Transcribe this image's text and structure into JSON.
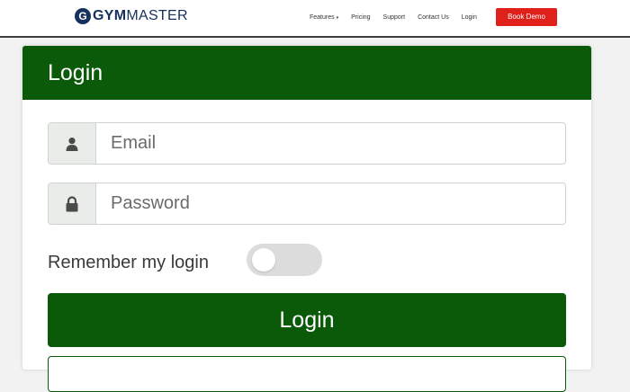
{
  "navbar": {
    "logo_mark": "G",
    "logo_gym": "GYM",
    "logo_master": "MASTER",
    "links": [
      {
        "label": "Features",
        "has_caret": true
      },
      {
        "label": "Pricing"
      },
      {
        "label": "Support"
      },
      {
        "label": "Contact Us"
      },
      {
        "label": "Login"
      }
    ],
    "caret_glyph": "▾",
    "demo_button_label": "Book Demo",
    "demo_button_color": "#e0201a"
  },
  "login_card": {
    "title": "Login",
    "header_color": "#0a5a0a",
    "email": {
      "placeholder": "Email",
      "value": "",
      "icon": "user-icon"
    },
    "password": {
      "placeholder": "Password",
      "value": "",
      "icon": "lock-icon"
    },
    "remember_label": "Remember my login",
    "remember_enabled": false,
    "submit_label": "Login"
  }
}
